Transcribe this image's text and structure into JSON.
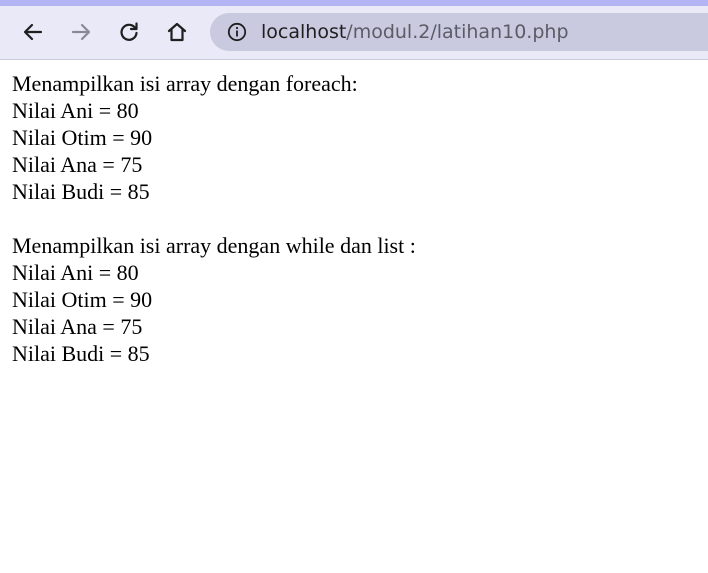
{
  "browser": {
    "url_host": "localhost",
    "url_path": "/modul.2/latihan10.php"
  },
  "page": {
    "section1": {
      "heading": "Menampilkan isi array dengan foreach:",
      "lines": [
        "Nilai Ani = 80",
        "Nilai Otim = 90",
        "Nilai Ana = 75",
        "Nilai Budi = 85"
      ]
    },
    "section2": {
      "heading": "Menampilkan isi array dengan while dan list :",
      "lines": [
        "Nilai Ani = 80",
        "Nilai Otim = 90",
        "Nilai Ana = 75",
        "Nilai Budi = 85"
      ]
    }
  },
  "icons": {
    "back": "arrow-left-icon",
    "forward": "arrow-right-icon",
    "reload": "reload-icon",
    "home": "home-icon",
    "site_info": "info-circle-icon"
  },
  "colors": {
    "toolbar_bg": "#e9e9f8",
    "accent_bar": "#b3b4f3",
    "omnibox_bg": "#c9cae0"
  }
}
